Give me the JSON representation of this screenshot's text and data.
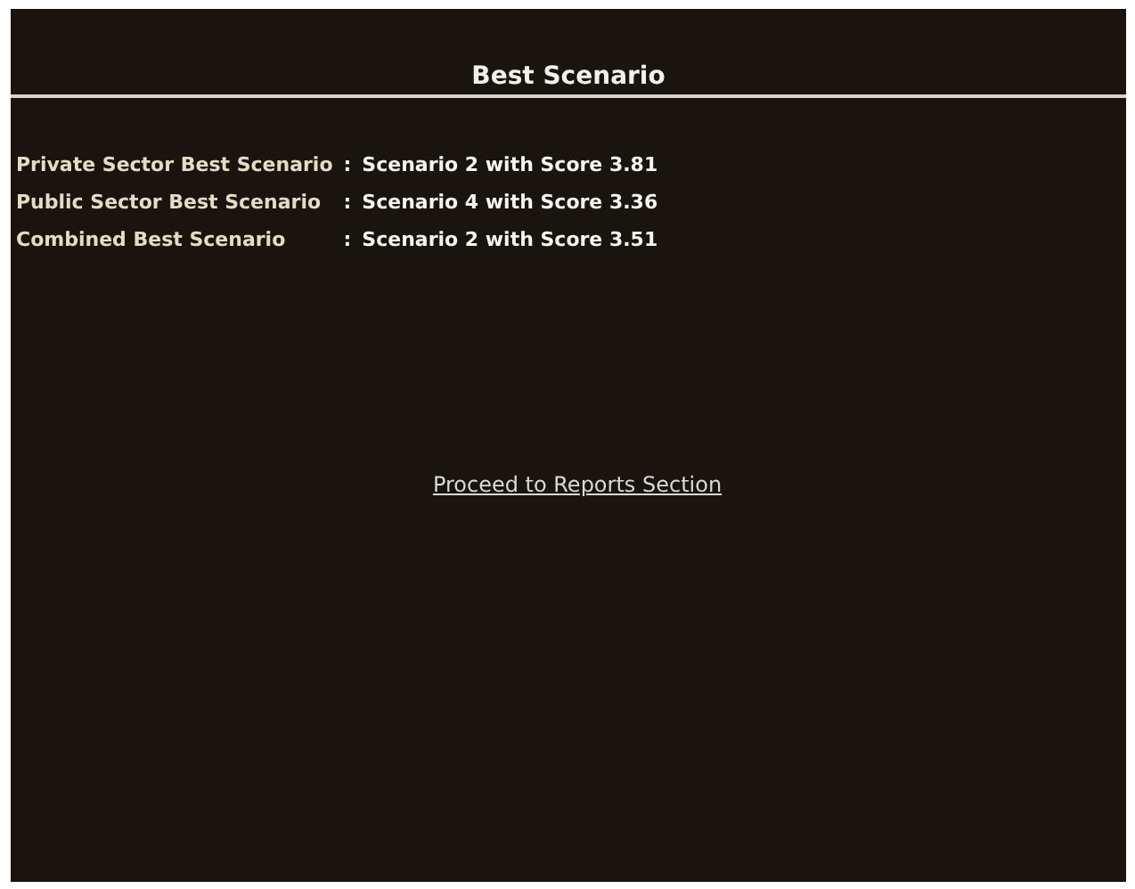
{
  "title": "Best Scenario",
  "results": [
    {
      "label": "Private Sector Best Scenario",
      "separator": ":",
      "value": "Scenario 2 with Score 3.81"
    },
    {
      "label": "Public Sector Best Scenario",
      "separator": ":",
      "value": "Scenario 4 with Score 3.36"
    },
    {
      "label": "Combined Best Scenario",
      "separator": ":",
      "value": "Scenario 2 with Score 3.51"
    }
  ],
  "link": "Proceed to Reports Section"
}
